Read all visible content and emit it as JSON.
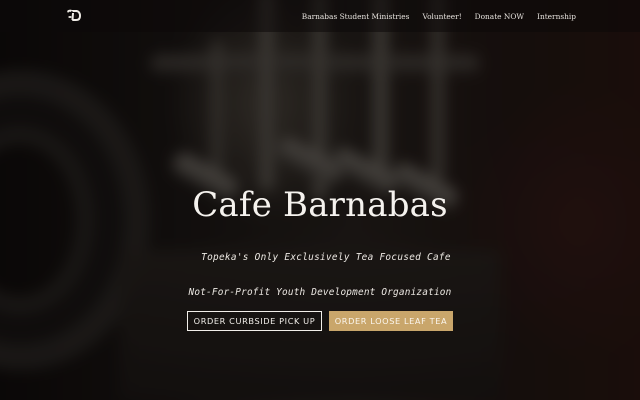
{
  "nav": {
    "logo_icon": "tea-logo-icon",
    "links": [
      "Barnabas Student Ministries",
      "Volunteer!",
      "Donate NOW",
      "Internship"
    ]
  },
  "hero": {
    "title": "Cafe Barnabas",
    "tagline": "Topeka's Only Exclusively Tea Focused Cafe",
    "subline": "Not-For-Profit Youth Development Organization",
    "buttons": {
      "curbside": "ORDER CURBSIDE PICK UP",
      "loose_leaf": "ORDER LOOSE LEAF TEA"
    }
  },
  "colors": {
    "accent_gold": "#c9a66b",
    "text_light": "#f2efea"
  }
}
